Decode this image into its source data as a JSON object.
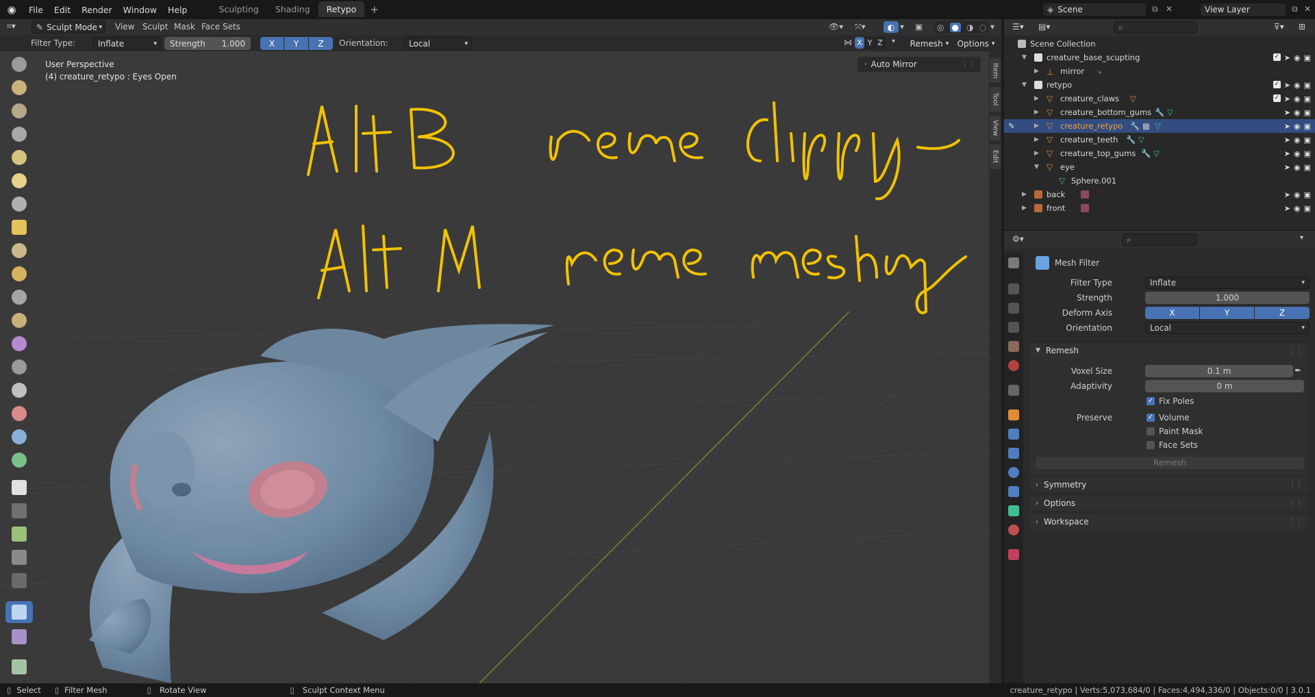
{
  "app": {
    "menu": [
      "File",
      "Edit",
      "Render",
      "Window",
      "Help"
    ],
    "workspaces": [
      "Sculpting",
      "Shading",
      "Retypo"
    ],
    "active_workspace": "Retypo",
    "scene": "Scene",
    "view_layer": "View Layer"
  },
  "header": {
    "mode": "Sculpt Mode",
    "menus": [
      "View",
      "Sculpt",
      "Mask",
      "Face Sets"
    ],
    "remesh_label": "Remesh",
    "options_label": "Options"
  },
  "tool_settings": {
    "filter_type_label": "Filter Type:",
    "filter_type": "Inflate",
    "strength_label": "Strength",
    "strength": "1.000",
    "axes": [
      "X",
      "Y",
      "Z"
    ],
    "orientation_label": "Orientation:",
    "orientation": "Local"
  },
  "viewport": {
    "perspective": "User Perspective",
    "object_info": "(4) creature_retypo : Eyes Open",
    "auto_mirror": "Auto Mirror",
    "side_tabs": [
      "Item",
      "Tool",
      "View",
      "Edit"
    ],
    "annotation": {
      "line1_key": "Alt B",
      "line1_text": "remove clipping",
      "line2_key": "Alt M",
      "line2_text": "remove masking",
      "color": "#f2c200"
    }
  },
  "outliner": {
    "root": "Scene Collection",
    "rows": [
      {
        "name": "creature_base_scupting",
        "type": "collection"
      },
      {
        "name": "mirror",
        "type": "empty"
      },
      {
        "name": "retypo",
        "type": "collection"
      },
      {
        "name": "creature_claws",
        "type": "mesh"
      },
      {
        "name": "creature_bottom_gums",
        "type": "mesh"
      },
      {
        "name": "creature_retypo",
        "type": "mesh",
        "selected": true
      },
      {
        "name": "creature_teeth",
        "type": "mesh"
      },
      {
        "name": "creature_top_gums",
        "type": "mesh"
      },
      {
        "name": "eye",
        "type": "mesh"
      },
      {
        "name": "Sphere.001",
        "type": "data"
      },
      {
        "name": "back",
        "type": "image"
      },
      {
        "name": "front",
        "type": "image"
      }
    ]
  },
  "properties": {
    "tool_name": "Mesh Filter",
    "filter_type_label": "Filter Type",
    "filter_type": "Inflate",
    "strength_label": "Strength",
    "strength": "1.000",
    "deform_axis_label": "Deform Axis",
    "deform_axes": [
      "X",
      "Y",
      "Z"
    ],
    "orientation_label": "Orientation",
    "orientation": "Local",
    "remesh": {
      "title": "Remesh",
      "voxel_size_label": "Voxel Size",
      "voxel_size": "0.1 m",
      "adaptivity_label": "Adaptivity",
      "adaptivity": "0 m",
      "fix_poles": "Fix Poles",
      "preserve_label": "Preserve",
      "volume": "Volume",
      "paint_mask": "Paint Mask",
      "face_sets": "Face Sets",
      "button": "Remesh"
    },
    "panels": [
      "Symmetry",
      "Options",
      "Workspace"
    ]
  },
  "statusbar": {
    "select": "Select",
    "filter_mesh": "Filter Mesh",
    "rotate_view": "Rotate View",
    "context_menu": "Sculpt Context Menu",
    "stats": "creature_retypo | Verts:5,073,684/0 | Faces:4,494,336/0 | Objects:0/0 | 3.0.1"
  }
}
